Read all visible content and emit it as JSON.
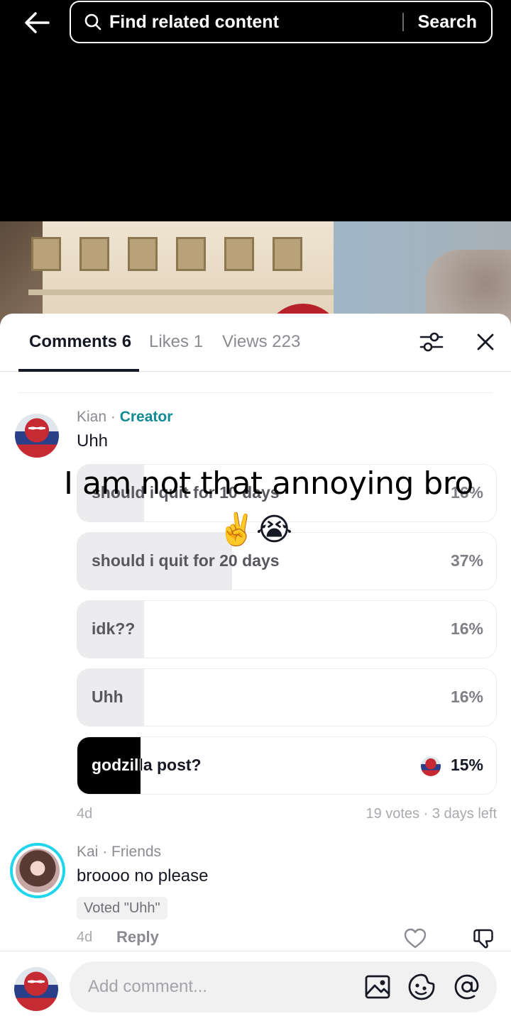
{
  "topbar": {
    "back_icon": "arrow-left-icon",
    "search_placeholder": "Find related content",
    "search_button": "Search"
  },
  "tabs": [
    {
      "label": "Comments 6",
      "active": true
    },
    {
      "label": "Likes 1",
      "active": false
    },
    {
      "label": "Views 223",
      "active": false
    }
  ],
  "comment1": {
    "author": "Kian",
    "badge": "Creator",
    "text": "Uhh",
    "poll": {
      "options": [
        {
          "label": "should i quit for 10 days",
          "percent": "16%",
          "fill": 0.16
        },
        {
          "label": "should i quit for 20 days",
          "percent": "37%",
          "fill": 0.37
        },
        {
          "label": "idk??",
          "percent": "16%",
          "fill": 0.16
        },
        {
          "label": "Uhh",
          "percent": "16%",
          "fill": 0.16
        },
        {
          "label": "godzilla post?",
          "percent": "15%",
          "fill": 0.15,
          "selected": true
        }
      ],
      "age": "4d",
      "summary": "19 votes · 3 days left"
    }
  },
  "overlay": {
    "caption": "I am not that annoying bro",
    "emoji": "✌️😭"
  },
  "comment2": {
    "author": "Kai",
    "relation": "Friends",
    "text": "broooo no please",
    "voted": "Voted \"Uhh\"",
    "age": "4d",
    "reply": "Reply"
  },
  "input": {
    "placeholder": "Add comment..."
  },
  "colors": {
    "creator_badge": "#128a93",
    "story_ring": "#20d5ec",
    "selected_fill": "#000000"
  }
}
